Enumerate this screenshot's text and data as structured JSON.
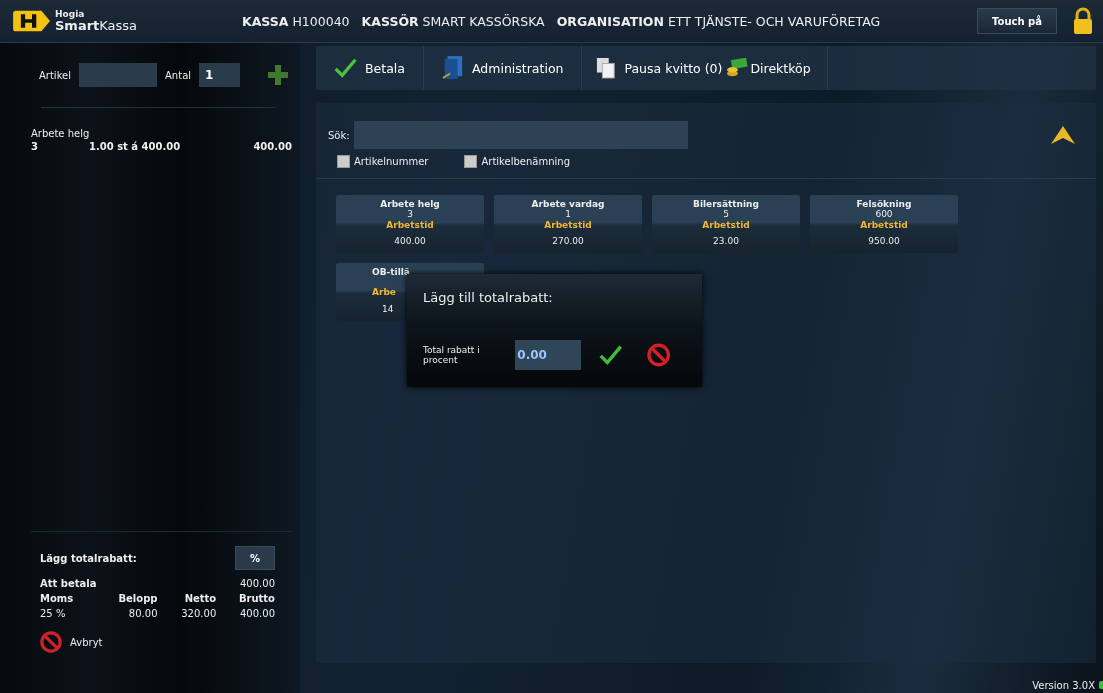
{
  "header": {
    "logo_small": "Hogia",
    "logo_big": "Smart",
    "logo_rest": "Kassa",
    "info": [
      {
        "label": "KASSA",
        "value": "H100040"
      },
      {
        "label": "KASSÖR",
        "value": "SMART KASSÖRSKA"
      },
      {
        "label": "ORGANISATION",
        "value": "ETT TJÄNSTE- OCH VARUFÖRETAG"
      }
    ],
    "touch_button": "Touch på"
  },
  "entry": {
    "article_label": "Artikel",
    "quantity_label": "Antal",
    "quantity": "1"
  },
  "receipt": [
    {
      "name": "Arbete helg",
      "number": "3",
      "detail": "1.00 st á 400.00",
      "amount": "400.00"
    }
  ],
  "summary": {
    "discount_label": "Lägg totalrabatt:",
    "discount_button": "%",
    "pay_label": "Att betala",
    "pay_amount": "400.00",
    "vat_columns": [
      "Moms",
      "Belopp",
      "Netto",
      "Brutto"
    ],
    "vat_rows": [
      [
        "25 %",
        "80.00",
        "320.00",
        "400.00"
      ]
    ],
    "cancel": "Avbryt"
  },
  "toolbar": [
    {
      "kind": "check",
      "label": "Betala"
    },
    {
      "kind": "admin",
      "label": "Administration"
    },
    {
      "kind": "pages",
      "label": "Pausa kvitto (0)"
    },
    {
      "kind": "money",
      "label": "Direktköp"
    }
  ],
  "search": {
    "label": "Sök:",
    "filters": [
      {
        "label": "Artikelnummer",
        "checked": false
      },
      {
        "label": "Artikelbenämning",
        "checked": false
      }
    ]
  },
  "tiles": [
    {
      "kind": "full",
      "name": "Arbete helg",
      "number": "3",
      "category": "Arbetstid",
      "price": "400.00"
    },
    {
      "kind": "full",
      "name": "Arbete vardag",
      "number": "1",
      "category": "Arbetstid",
      "price": "270.00"
    },
    {
      "kind": "full",
      "name": "Bilersättning",
      "number": "5",
      "category": "Arbetstid",
      "price": "23.00"
    },
    {
      "kind": "full",
      "name": "Felsökning",
      "number": "600",
      "category": "Arbetstid",
      "price": "950.00"
    },
    {
      "kind": "partial",
      "name": "OB-tillä",
      "category": "Arbe",
      "price": "14"
    }
  ],
  "dialog": {
    "title": "Lägg till totalrabatt:",
    "field_label": "Total rabatt i procent",
    "value": "0.00"
  },
  "status": {
    "version": "Version 3.0X"
  }
}
